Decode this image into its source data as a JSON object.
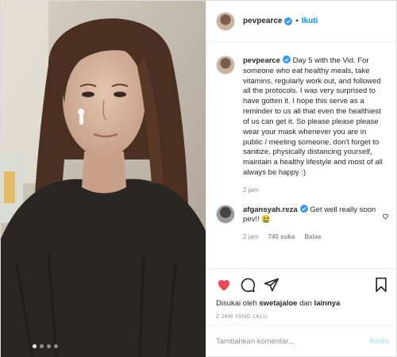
{
  "post": {
    "photo": {
      "description_icon": "photo-image",
      "carousel_count": 4,
      "carousel_active": 1
    },
    "header": {
      "username": "pevpearce",
      "separator": "•",
      "follow_label": "Ikuti"
    },
    "caption": {
      "username": "pevpearce",
      "text": "Day 5 with the Vid. For someone who eat healthy meals, take vitamins, regularly work out, and followed all the protocols. I was very surprised to have gotten it. I hope this serve as a reminder to us all that even the healthiest of us can get it. So please please please wear your mask whenever you are in public / meeting someone, don't forget to sanitize, physically distancing yourself, maintain a healthy lifestyle and most of all always be happy :)",
      "time": "2 jam"
    },
    "reply": {
      "username": "afgansyah.reza",
      "text": "Get well really soon pev!! 🤮",
      "time": "2 jam",
      "likes": "745 suka",
      "reply_label": "Balas"
    },
    "actions": {
      "liked_by_prefix": "Disukai oleh",
      "liked_by_user": "swetajaloe",
      "liked_by_joiner": "dan",
      "liked_by_others": "lainnya",
      "time_ago": "2 JAM YANG LALU"
    },
    "add_comment": {
      "placeholder": "Tambahkan komentar...",
      "post_label": "Kirim"
    },
    "colors": {
      "accent": "#0095f6",
      "heart": "#ed4956",
      "muted": "#8e8e8e"
    }
  }
}
